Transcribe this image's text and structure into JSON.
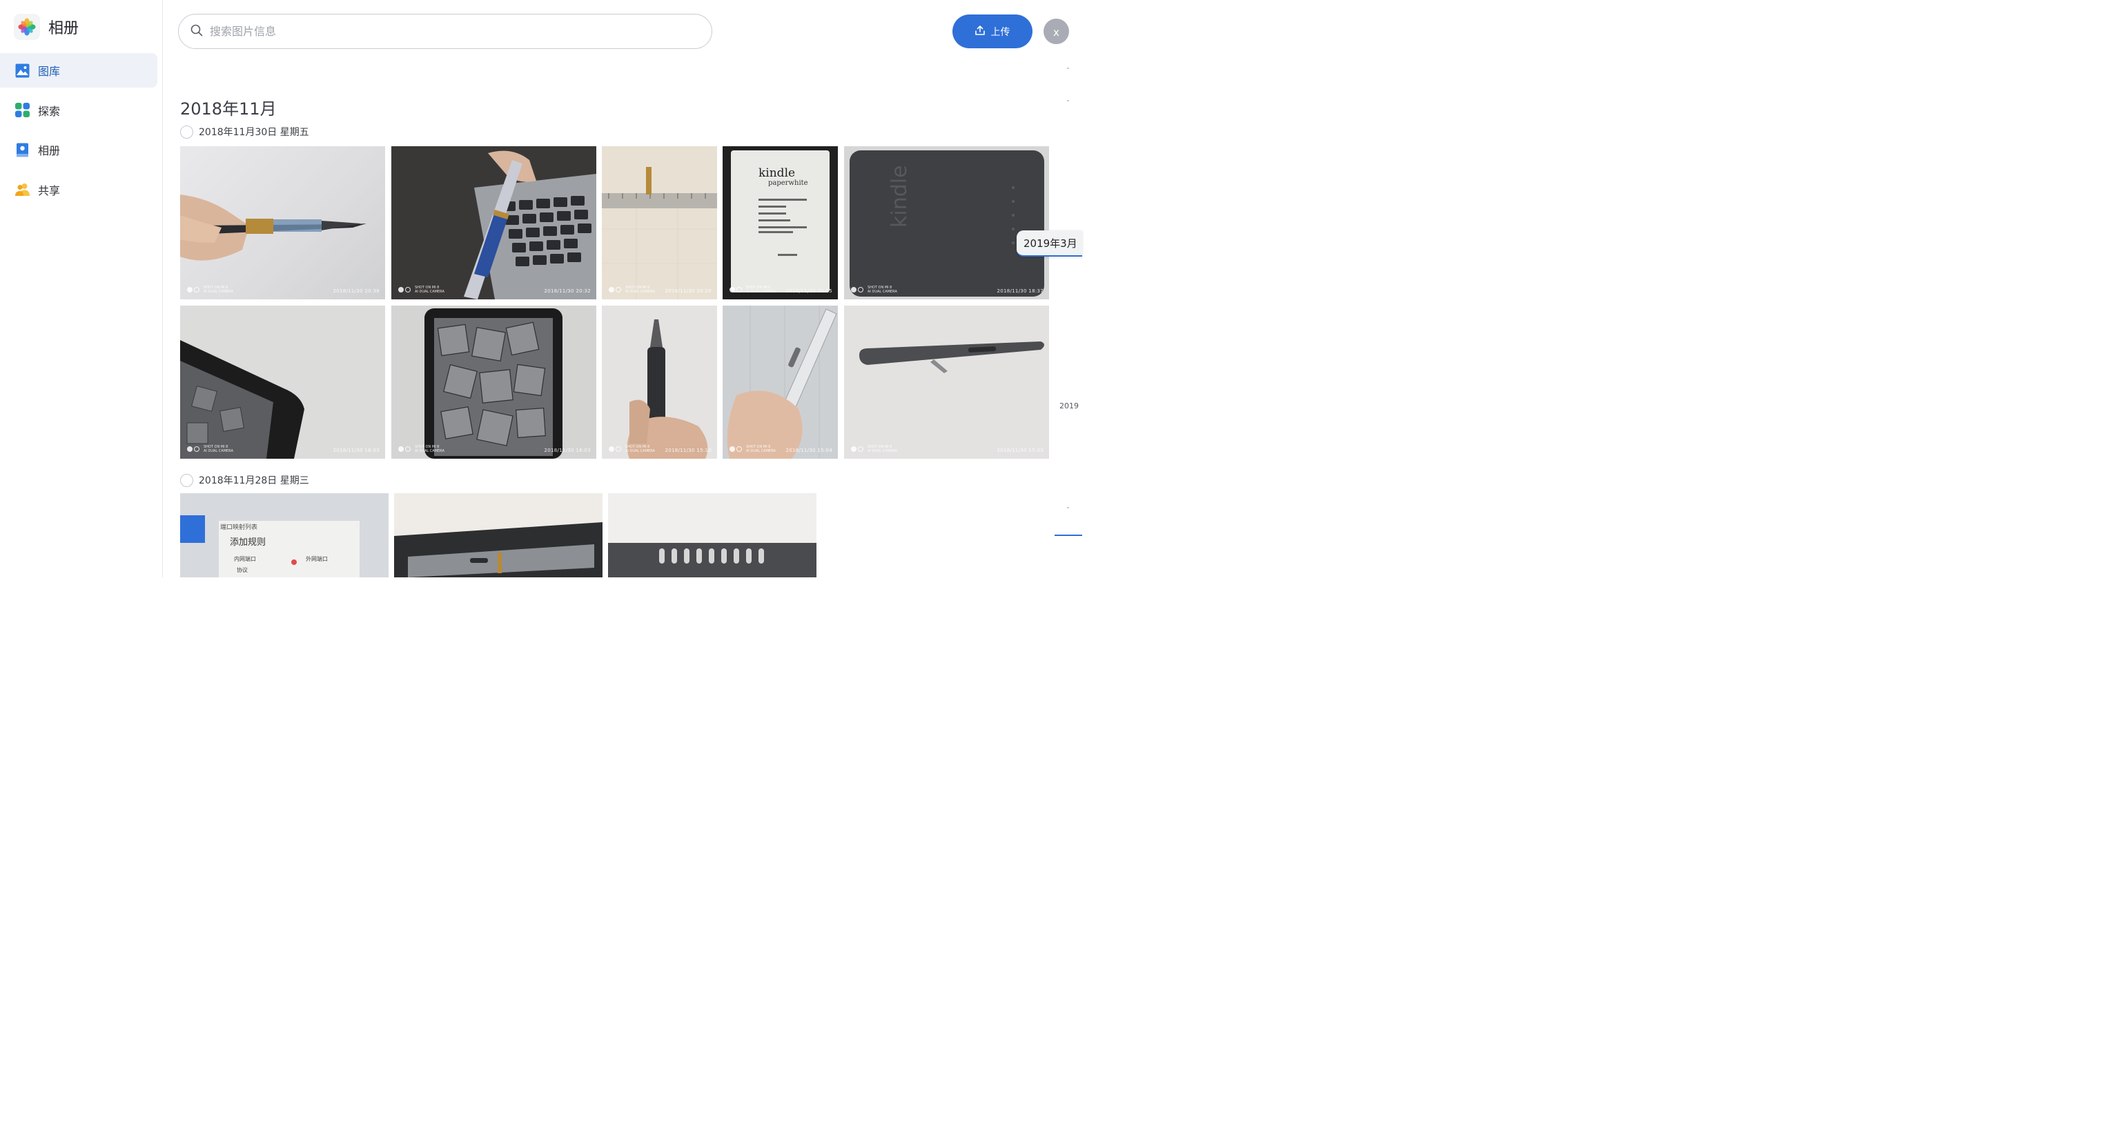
{
  "app": {
    "title": "相册"
  },
  "sidebar": {
    "items": [
      {
        "label": "图库",
        "icon": "gallery-icon",
        "active": true
      },
      {
        "label": "探索",
        "icon": "explore-icon",
        "active": false
      },
      {
        "label": "相册",
        "icon": "album-icon",
        "active": false
      },
      {
        "label": "共享",
        "icon": "share-icon",
        "active": false
      }
    ]
  },
  "header": {
    "search_placeholder": "搜索图片信息",
    "upload_label": "上传",
    "avatar_initial": "x"
  },
  "gallery": {
    "month": "2018年11月",
    "groups": [
      {
        "date": "2018年11月30日 星期五",
        "photos": [
          {
            "subject": "fountain pen in hand",
            "timestamp": "2018/11/30  20:38"
          },
          {
            "subject": "blue pen over keyboard",
            "timestamp": "2018/11/30  20:32"
          },
          {
            "subject": "ruler with nib",
            "timestamp": "2018/11/30  20:20"
          },
          {
            "subject": "kindle paperwhite screen",
            "timestamp": "2018/11/30  20:15"
          },
          {
            "subject": "kindle back",
            "timestamp": "2018/11/30  18:37"
          },
          {
            "subject": "kindle corner",
            "timestamp": "2018/11/30  16:03"
          },
          {
            "subject": "kindle front",
            "timestamp": "2018/11/30  16:03"
          },
          {
            "subject": "pen nib upright",
            "timestamp": "2018/11/30  15:10"
          },
          {
            "subject": "silver pen in hand",
            "timestamp": "2018/11/30  15:04"
          },
          {
            "subject": "grey pen on table",
            "timestamp": "2018/11/30  15:03"
          }
        ]
      },
      {
        "date": "2018年11月28日 星期三",
        "photos": [
          {
            "subject": "screen dialog",
            "screen_text_1": "端口映射列表",
            "screen_text_2": "添加规则",
            "screen_text_3": "内网端口",
            "screen_text_4": "外网端口",
            "screen_text_5": "协议"
          },
          {
            "subject": "pen case"
          },
          {
            "subject": "keyboard slots"
          }
        ]
      }
    ],
    "watermark_line1": "SHOT ON MI 8",
    "watermark_line2": "AI DUAL CAMERA"
  },
  "timeline": {
    "current_label": "2019年3月",
    "year_label": "2019"
  },
  "colors": {
    "accent": "#2f6fd8",
    "nav_active_bg": "#eef2f8"
  }
}
